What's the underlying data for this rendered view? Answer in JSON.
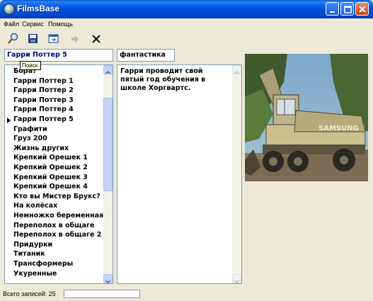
{
  "window": {
    "title": "FilmsBase"
  },
  "menu": [
    "Файл",
    "Сервис",
    "Помощь"
  ],
  "toolbar": [
    "search-icon",
    "save-icon",
    "export-icon",
    "arrow-right-icon",
    "delete-icon"
  ],
  "search": {
    "value": "Гарри Поттер 5",
    "tooltip": "Поиск"
  },
  "genre": "фантастика",
  "films": {
    "items": [
      "Бора?",
      "Гарри Поттер 1",
      "Гарри Поттер 2",
      "Гарри Поттер 3",
      "Гарри Поттер 4",
      "Гарри Поттер 5",
      "Графити",
      "Груз 200",
      "Жизнь других",
      "Крепкий Орешек 1",
      "Крепкий Орешек 2",
      "Крепкий Орешек 3",
      "Крепкий Орешек 4",
      "Кто вы Мистер Брукс?",
      "На колёсах",
      "Немножко беременная",
      "Переполох в общаге",
      "Переполох в общаге 2",
      "Придурки",
      "Титаник",
      "Трансформеры",
      "Укуренные"
    ],
    "selected_index": 5
  },
  "description": "Гарри проводит свой пятый год обучения в школе Хоргвартс.",
  "photo": {
    "truck_brand": "SAMSUNG"
  },
  "status": {
    "label": "Всего записей: 25"
  },
  "colors": {
    "titlebar": "#0054E3",
    "face": "#ECE9D8",
    "field_border": "#7F9DB9",
    "search_text": "#000080"
  }
}
